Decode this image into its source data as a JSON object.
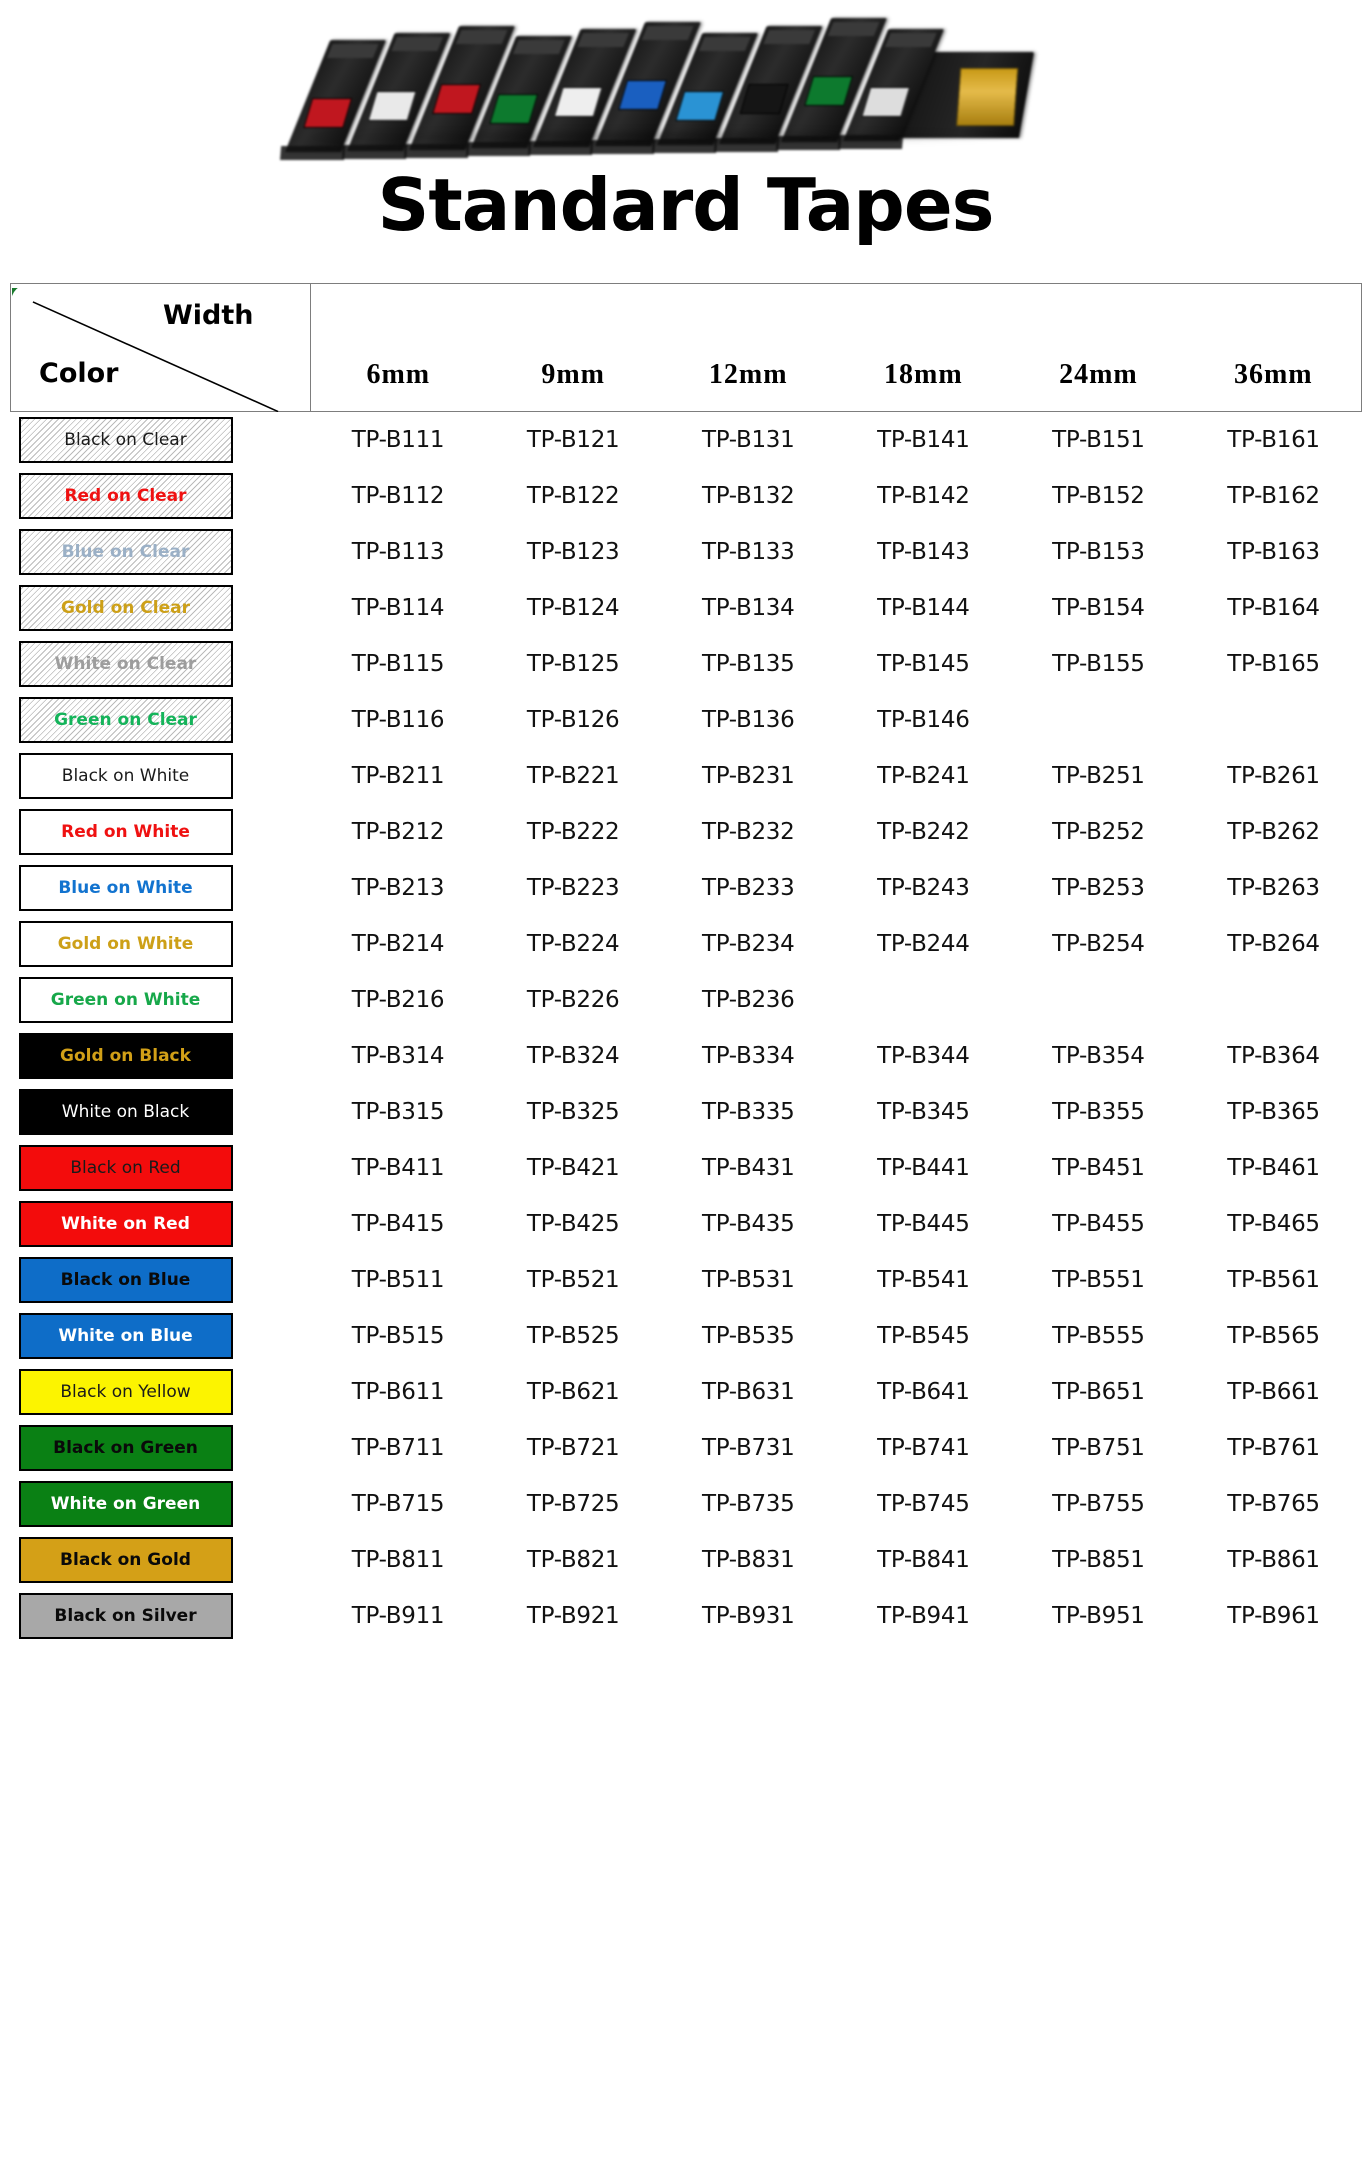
{
  "page": {
    "title": "Standard Tapes",
    "hero_alt": "label-tape-cartridges-photo"
  },
  "table": {
    "corner": {
      "width_label": "Width",
      "color_label": "Color"
    },
    "widths": [
      "6mm",
      "9mm",
      "12mm",
      "18mm",
      "24mm",
      "36mm"
    ],
    "rows": [
      {
        "label": "Black on Clear",
        "bg": "clear",
        "fg": "#1a1a1a",
        "bold": false,
        "border": "#000000",
        "parts": [
          "TP-B111",
          "TP-B121",
          "TP-B131",
          "TP-B141",
          "TP-B151",
          "TP-B161"
        ]
      },
      {
        "label": "Red on Clear",
        "bg": "clear",
        "fg": "#ef1111",
        "bold": true,
        "border": "#000000",
        "parts": [
          "TP-B112",
          "TP-B122",
          "TP-B132",
          "TP-B142",
          "TP-B152",
          "TP-B162"
        ]
      },
      {
        "label": "Blue on Clear",
        "bg": "clear",
        "fg": "#9bb0c6",
        "bold": true,
        "border": "#000000",
        "parts": [
          "TP-B113",
          "TP-B123",
          "TP-B133",
          "TP-B143",
          "TP-B153",
          "TP-B163"
        ]
      },
      {
        "label": "Gold on Clear",
        "bg": "clear",
        "fg": "#cda018",
        "bold": true,
        "border": "#000000",
        "parts": [
          "TP-B114",
          "TP-B124",
          "TP-B134",
          "TP-B144",
          "TP-B154",
          "TP-B164"
        ]
      },
      {
        "label": "White on Clear",
        "bg": "clear",
        "fg": "#9d9d9d",
        "bold": true,
        "border": "#000000",
        "parts": [
          "TP-B115",
          "TP-B125",
          "TP-B135",
          "TP-B145",
          "TP-B155",
          "TP-B165"
        ]
      },
      {
        "label": "Green on Clear",
        "bg": "clear",
        "fg": "#14b45a",
        "bold": true,
        "border": "#000000",
        "parts": [
          "TP-B116",
          "TP-B126",
          "TP-B136",
          "TP-B146",
          "",
          ""
        ]
      },
      {
        "label": "Black on White",
        "bg": "#ffffff",
        "fg": "#1a1a1a",
        "bold": false,
        "border": "#000000",
        "parts": [
          "TP-B211",
          "TP-B221",
          "TP-B231",
          "TP-B241",
          "TP-B251",
          "TP-B261"
        ]
      },
      {
        "label": "Red on White",
        "bg": "#ffffff",
        "fg": "#ef1111",
        "bold": true,
        "border": "#000000",
        "parts": [
          "TP-B212",
          "TP-B222",
          "TP-B232",
          "TP-B242",
          "TP-B252",
          "TP-B262"
        ]
      },
      {
        "label": "Blue on White",
        "bg": "#ffffff",
        "fg": "#1273cf",
        "bold": true,
        "border": "#000000",
        "parts": [
          "TP-B213",
          "TP-B223",
          "TP-B233",
          "TP-B243",
          "TP-B253",
          "TP-B263"
        ]
      },
      {
        "label": "Gold on White",
        "bg": "#ffffff",
        "fg": "#cda018",
        "bold": true,
        "border": "#000000",
        "parts": [
          "TP-B214",
          "TP-B224",
          "TP-B234",
          "TP-B244",
          "TP-B254",
          "TP-B264"
        ]
      },
      {
        "label": "Green on White",
        "bg": "#ffffff",
        "fg": "#17a84a",
        "bold": true,
        "border": "#000000",
        "parts": [
          "TP-B216",
          "TP-B226",
          "TP-B236",
          "",
          "",
          ""
        ]
      },
      {
        "label": "Gold on Black",
        "bg": "#000000",
        "fg": "#d2a017",
        "bold": true,
        "border": "#000000",
        "parts": [
          "TP-B314",
          "TP-B324",
          "TP-B334",
          "TP-B344",
          "TP-B354",
          "TP-B364"
        ]
      },
      {
        "label": "White on Black",
        "bg": "#000000",
        "fg": "#ffffff",
        "bold": false,
        "border": "#000000",
        "parts": [
          "TP-B315",
          "TP-B325",
          "TP-B335",
          "TP-B345",
          "TP-B355",
          "TP-B365"
        ]
      },
      {
        "label": "Black on Red",
        "bg": "#f30c0c",
        "fg": "#1a1a1a",
        "bold": false,
        "border": "#000000",
        "parts": [
          "TP-B411",
          "TP-B421",
          "TP-B431",
          "TP-B441",
          "TP-B451",
          "TP-B461"
        ]
      },
      {
        "label": "White on Red",
        "bg": "#f30c0c",
        "fg": "#ffffff",
        "bold": true,
        "border": "#000000",
        "parts": [
          "TP-B415",
          "TP-B425",
          "TP-B435",
          "TP-B445",
          "TP-B455",
          "TP-B465"
        ]
      },
      {
        "label": "Black on Blue",
        "bg": "#0e6dc8",
        "fg": "#0a0a0a",
        "bold": true,
        "border": "#000000",
        "parts": [
          "TP-B511",
          "TP-B521",
          "TP-B531",
          "TP-B541",
          "TP-B551",
          "TP-B561"
        ]
      },
      {
        "label": "White on Blue",
        "bg": "#0e6dc8",
        "fg": "#ffffff",
        "bold": true,
        "border": "#000000",
        "parts": [
          "TP-B515",
          "TP-B525",
          "TP-B535",
          "TP-B545",
          "TP-B555",
          "TP-B565"
        ]
      },
      {
        "label": "Black on Yellow",
        "bg": "#fcf400",
        "fg": "#1a1a1a",
        "bold": false,
        "border": "#000000",
        "parts": [
          "TP-B611",
          "TP-B621",
          "TP-B631",
          "TP-B641",
          "TP-B651",
          "TP-B661"
        ]
      },
      {
        "label": "Black on Green",
        "bg": "#0a8014",
        "fg": "#0a0a0a",
        "bold": true,
        "border": "#000000",
        "parts": [
          "TP-B711",
          "TP-B721",
          "TP-B731",
          "TP-B741",
          "TP-B751",
          "TP-B761"
        ]
      },
      {
        "label": "White on Green",
        "bg": "#0a8014",
        "fg": "#ffffff",
        "bold": true,
        "border": "#000000",
        "parts": [
          "TP-B715",
          "TP-B725",
          "TP-B735",
          "TP-B745",
          "TP-B755",
          "TP-B765"
        ]
      },
      {
        "label": "Black on Gold",
        "bg": "#d4a017",
        "fg": "#0a0a0a",
        "bold": true,
        "border": "#000000",
        "parts": [
          "TP-B811",
          "TP-B821",
          "TP-B831",
          "TP-B841",
          "TP-B851",
          "TP-B861"
        ]
      },
      {
        "label": "Black on Silver",
        "bg": "#a8a8a8",
        "fg": "#0a0a0a",
        "bold": true,
        "border": "#000000",
        "parts": [
          "TP-B911",
          "TP-B921",
          "TP-B931",
          "TP-B941",
          "TP-B951",
          "TP-B961"
        ]
      }
    ]
  },
  "hero_cartridges": [
    {
      "chip": "#c0171f"
    },
    {
      "chip": "#e9e9e9"
    },
    {
      "chip": "#c0171f"
    },
    {
      "chip": "#0d7a2e"
    },
    {
      "chip": "#eeeeee"
    },
    {
      "chip": "#1a5fc0"
    },
    {
      "chip": "#2a93d4"
    },
    {
      "chip": "#151515"
    },
    {
      "chip": "#0d7a2e"
    },
    {
      "chip": "#dddddd"
    }
  ]
}
